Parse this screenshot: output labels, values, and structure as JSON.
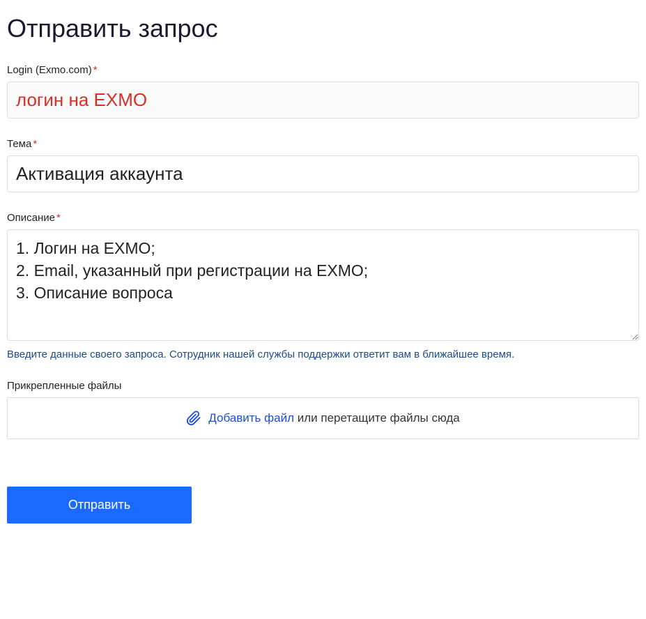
{
  "page_title": "Отправить запрос",
  "fields": {
    "login": {
      "label": "Login (Exmo.com)",
      "required_mark": "*",
      "value": "логин на EXMO"
    },
    "subject": {
      "label": "Тема",
      "required_mark": "*",
      "value": "Активация аккаунта"
    },
    "description": {
      "label": "Описание",
      "required_mark": "*",
      "value": "1. Логин на EXMO;\n2. Email, указанный при регистрации на EXMO;\n3. Описание вопроса",
      "hint": "Введите данные своего запроса. Сотрудник нашей службы поддержки ответит вам в ближайшее время."
    },
    "attachments": {
      "label": "Прикрепленные файлы",
      "link_text": "Добавить файл",
      "drag_text": " или перетащите файлы сюда"
    }
  },
  "submit_label": "Отправить"
}
